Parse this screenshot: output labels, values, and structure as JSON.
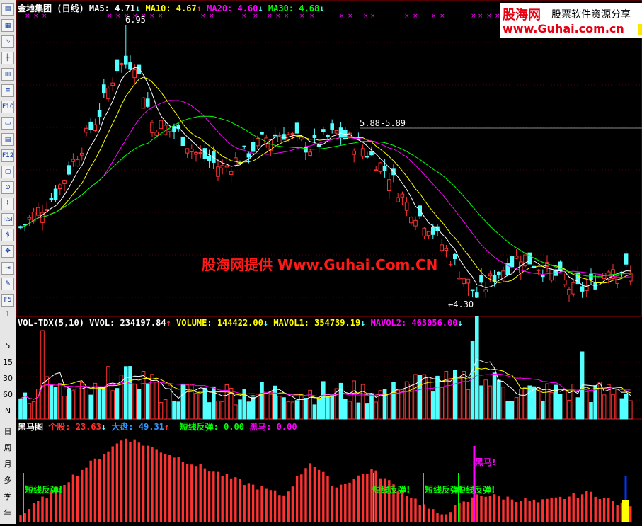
{
  "price_panel": {
    "title": "金地集团 (日线)",
    "ma5": {
      "label": "MA5:",
      "value": "4.71",
      "arrow": "↓",
      "color": "#ffffff"
    },
    "ma10": {
      "label": "MA10:",
      "value": "4.67",
      "arrow": "↑",
      "color": "#ffff00"
    },
    "ma20": {
      "label": "MA20:",
      "value": "4.60",
      "arrow": "↓",
      "color": "#ff00ff"
    },
    "ma30": {
      "label": "MA30:",
      "value": "4.68",
      "arrow": "↓",
      "color": "#00ff00"
    },
    "high_label": "6.95",
    "low_label": "4.30",
    "resistance_label": "5.88-5.89"
  },
  "volume_panel": {
    "title": "VOL-TDX(5,10)",
    "vvol": {
      "label": "VVOL:",
      "value": "234197.84",
      "arrow": "↑",
      "color": "#ffffff"
    },
    "volume": {
      "label": "VOLUME:",
      "value": "144422.00",
      "arrow": "↓",
      "color": "#ffff00"
    },
    "mavol1": {
      "label": "MAVOL1:",
      "value": "354739.19",
      "arrow": "↓",
      "color": "#ffff00"
    },
    "mavol2": {
      "label": "MAVOL2:",
      "value": "463056.00",
      "arrow": "↓",
      "color": "#ff00ff"
    }
  },
  "indicator_panel": {
    "title": "黑马图",
    "stock": {
      "label": "个股:",
      "value": "23.63",
      "arrow": "↓",
      "color": "#ff3333"
    },
    "market": {
      "label": "大盘:",
      "value": "49.31",
      "arrow": "↑",
      "color": "#3399ff"
    },
    "rebound": {
      "label": "短线反弹:",
      "value": "0.00",
      "color": "#00ff00"
    },
    "darkhorse": {
      "label": "黑马:",
      "value": "0.00",
      "color": "#ff00ff"
    },
    "rebound_marker": "短线反弹!",
    "darkhorse_marker": "黑马!"
  },
  "left_axis_labels": [
    "1",
    "5",
    "15",
    "30",
    "60",
    "N",
    "日",
    "周",
    "月",
    "多",
    "季",
    "年"
  ],
  "toolbar_icons": [
    "list-icon",
    "table-icon",
    "line-chart-icon",
    "kline-icon",
    "grid-icon",
    "text-icon",
    "f10-icon",
    "note-icon",
    "report-icon",
    "f12-icon",
    "window-icon",
    "search-icon",
    "index-icon",
    "rsi-icon",
    "dollar-icon",
    "move-icon",
    "exit-icon",
    "pencil-icon",
    "f5-icon"
  ],
  "toolbar_labels": {
    "f10": "F10",
    "rsi": "RSI",
    "f12": "F12",
    "f5": "F5"
  },
  "logo": {
    "brand": "股海网",
    "tagline": "股票软件资源分享",
    "url": "www.Guhai.com.cn"
  },
  "watermark": "股海网提供 Www.Guhai.Com.CN",
  "colors": {
    "up": "#ff3232",
    "down": "#54ffff",
    "ma5": "#ffffff",
    "ma10": "#ffff00",
    "ma20": "#ff00ff",
    "ma30": "#00ff00"
  }
}
